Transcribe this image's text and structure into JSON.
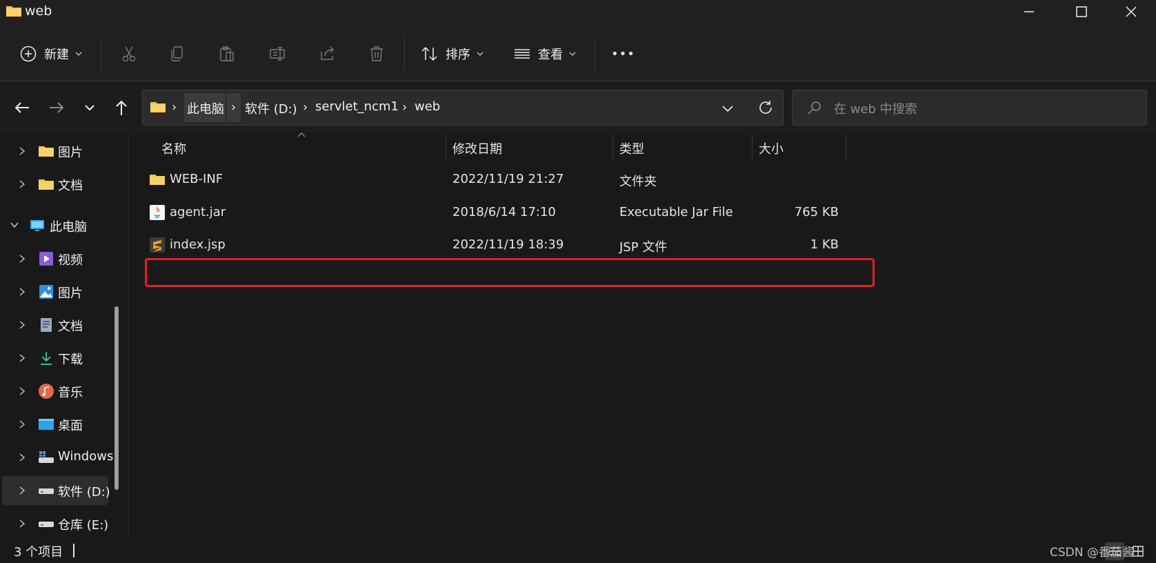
{
  "window": {
    "title": "web"
  },
  "toolbar": {
    "new_label": "新建",
    "sort_label": "排序",
    "view_label": "查看",
    "more_label": "•••"
  },
  "address": {
    "crumbs": [
      "此电脑",
      "软件 (D:)",
      "servlet_ncm1",
      "web"
    ]
  },
  "search": {
    "placeholder": "在 web 中搜索"
  },
  "sidebar": {
    "items": [
      {
        "label": "图片",
        "icon": "folder-icon"
      },
      {
        "label": "文档",
        "icon": "folder-icon"
      },
      {
        "label": "此电脑",
        "icon": "computer-icon"
      },
      {
        "label": "视频",
        "icon": "videos-icon"
      },
      {
        "label": "图片",
        "icon": "pictures-icon"
      },
      {
        "label": "文档",
        "icon": "documents-icon"
      },
      {
        "label": "下载",
        "icon": "downloads-icon"
      },
      {
        "label": "音乐",
        "icon": "music-icon"
      },
      {
        "label": "桌面",
        "icon": "desktop-icon"
      },
      {
        "label": "Windows",
        "icon": "windows-drive-icon"
      },
      {
        "label": "软件 (D:)",
        "icon": "drive-icon"
      },
      {
        "label": "仓库 (E:)",
        "icon": "drive-icon"
      }
    ]
  },
  "columns": {
    "name": "名称",
    "modified": "修改日期",
    "type": "类型",
    "size": "大小"
  },
  "files": [
    {
      "name": "WEB-INF",
      "modified": "2022/11/19 21:27",
      "type": "文件夹",
      "size": "",
      "icon": "folder-icon"
    },
    {
      "name": "agent.jar",
      "modified": "2018/6/14 17:10",
      "type": "Executable Jar File",
      "size": "765 KB",
      "icon": "java-jar-icon"
    },
    {
      "name": "index.jsp",
      "modified": "2022/11/19 18:39",
      "type": "JSP 文件",
      "size": "1 KB",
      "icon": "sublime-file-icon"
    }
  ],
  "status": {
    "count": "3 个项目",
    "watermark": "CSDN @番茄酱"
  },
  "colors": {
    "highlight_box": "#e32020",
    "folder": "#f2c14e"
  }
}
